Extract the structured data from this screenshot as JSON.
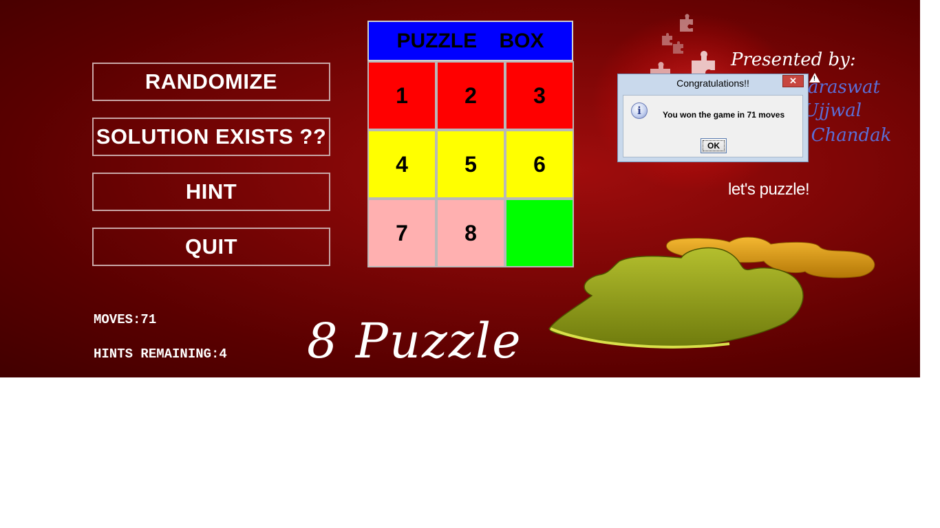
{
  "buttons": {
    "randomize": "RANDOMIZE",
    "solution_exists": "SOLUTION EXISTS ??",
    "hint": "HINT",
    "quit": "QUIT"
  },
  "stats": {
    "moves": "MOVES:71",
    "hints_remaining": "HINTS REMAINING:4"
  },
  "title_script": "8 Puzzle",
  "puzzle_box": {
    "header": "PUZZLE BOX",
    "tiles": [
      {
        "label": "1",
        "color": "#ff0000"
      },
      {
        "label": "2",
        "color": "#ff0000"
      },
      {
        "label": "3",
        "color": "#ff0000"
      },
      {
        "label": "4",
        "color": "#ffff00"
      },
      {
        "label": "5",
        "color": "#ffff00"
      },
      {
        "label": "6",
        "color": "#ffff00"
      },
      {
        "label": "7",
        "color": "#ffb0b0"
      },
      {
        "label": "8",
        "color": "#ffb0b0"
      },
      {
        "label": "",
        "color": "#00ff00"
      }
    ]
  },
  "credits": {
    "presented_by": "Presented by:",
    "authors": [
      "at Saraswat",
      "d Ujjwal",
      "l Chandak"
    ],
    "tagline": "let's puzzle!"
  },
  "dialog": {
    "title": "Congratulations!!",
    "close_label": "✕",
    "message": "You won the game in  71  moves",
    "ok_label": "OK"
  }
}
